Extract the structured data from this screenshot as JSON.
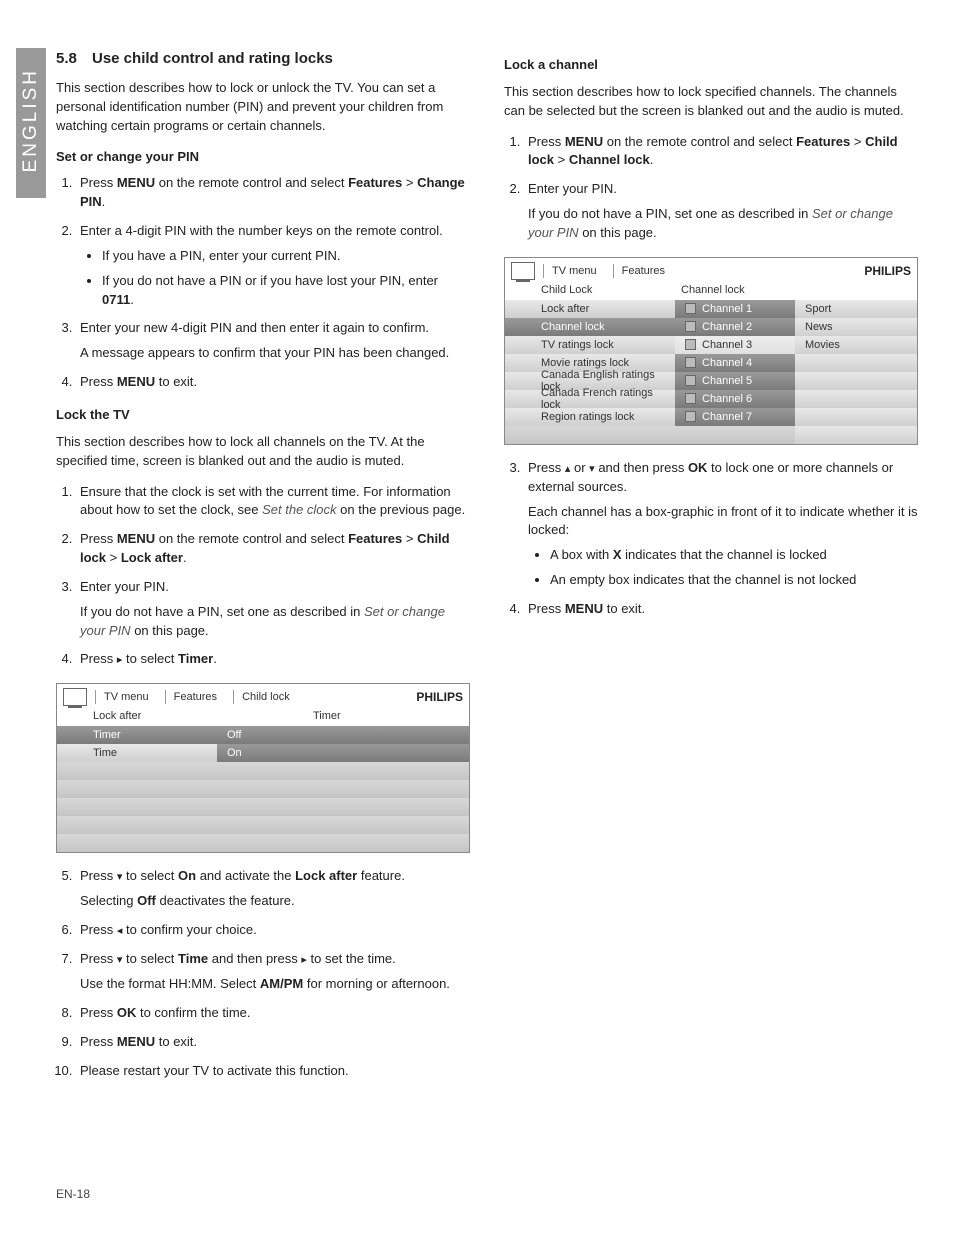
{
  "lang_tab": "ENGLISH",
  "footer": "EN-18",
  "left": {
    "heading_num": "5.8",
    "heading": "Use child control and rating locks",
    "intro": "This section describes how to lock or unlock the TV.  You can set a personal identification number (PIN) and prevent your children from watching certain programs or certain channels.",
    "pin_title": "Set or change your PIN",
    "s1a": "Press ",
    "s1b": "MENU",
    "s1c": " on the remote control and select ",
    "s1d": "Features",
    "s1e": " > ",
    "s1f": "Change PIN",
    "s1g": ".",
    "s2": "Enter a 4-digit PIN with the number keys on the remote control.",
    "s2b1": "If you have a PIN, enter your current PIN.",
    "s2b2a": "If you do not have a PIN or if you have lost your PIN, enter ",
    "s2b2b": "0711",
    "s2b2c": ".",
    "s3a": "Enter your new 4-digit PIN and then enter it again to confirm.",
    "s3b": "A message appears to confirm that your PIN has been changed.",
    "s4a": "Press ",
    "s4b": "MENU",
    "s4c": " to exit.",
    "lock_title_a": "L",
    "lock_title_b": "ock the TV",
    "lock_intro": "This section describes how to lock all channels on the TV.  At the specified time, screen is blanked out and the audio is muted.",
    "l1a": "Ensure that the clock is set with the current time.  For information about how to set the clock, see ",
    "l1b": "Set the clock",
    "l1c": " on the previous page.",
    "l2a": "Press ",
    "l2b": "MENU",
    "l2c": " on the remote control and select ",
    "l2d": "Features",
    "l2e": " > ",
    "l2f": "Child lock",
    "l2g": " > ",
    "l2h": "Lock after",
    "l2i": ".",
    "l3": "Enter your PIN.",
    "l3pa": "If you do not have a PIN, set one as described in ",
    "l3pb": "Set or change your PIN",
    "l3pc": " on this page.",
    "l4a": "Press ",
    "l4b": "▸",
    "l4c": " to select ",
    "l4d": "Timer",
    "l4e": ".",
    "l5a": "Press ",
    "l5b": "▾",
    "l5c": " to select ",
    "l5d": "On",
    "l5e": " and activate the ",
    "l5f": "Lock after",
    "l5g": " feature.",
    "l5h": "Selecting ",
    "l5i": "Off",
    "l5j": " deactivates the feature.",
    "l6a": "Press ",
    "l6b": "◂",
    "l6c": " to confirm your choice.",
    "l7a": "Press ",
    "l7b": "▾",
    "l7c": " to select ",
    "l7d": "Time",
    "l7e": " and then press ",
    "l7f": "▸",
    "l7g": " to set the time.",
    "l7h": "Use the format HH:MM.  Select ",
    "l7i": "AM/PM",
    "l7j": " for morning or afternoon.",
    "l8a": "Press ",
    "l8b": "OK",
    "l8c": " to confirm the time.",
    "l9a": "Press ",
    "l9b": "MENU",
    "l9c": " to exit.",
    "l10": "Please restart your TV to activate this function."
  },
  "menu1": {
    "brand": "PHILIPS",
    "crumbs": [
      "TV menu",
      "Features",
      "Child lock"
    ],
    "h1": "Lock after",
    "h2": "Timer",
    "rows": [
      {
        "a": "Timer",
        "b": "Off",
        "asel": true,
        "bsel": true
      },
      {
        "a": "Time",
        "b": "On",
        "bsel": true
      },
      {
        "a": "",
        "b": ""
      },
      {
        "a": "",
        "b": ""
      },
      {
        "a": "",
        "b": ""
      },
      {
        "a": "",
        "b": ""
      },
      {
        "a": "",
        "b": ""
      }
    ]
  },
  "right": {
    "title": "Lock a channel",
    "intro": "This section describes how to lock specified channels.  The channels can be selected but the screen is blanked out and the audio is muted.",
    "r1a": "Press ",
    "r1b": "MENU",
    "r1c": " on the remote control and select ",
    "r1d": "Features",
    "r1e": " > ",
    "r1f": "Child lock",
    "r1g": " > ",
    "r1h": "Channel lock",
    "r1i": ".",
    "r2": "Enter your PIN.",
    "r2pa": "If you do not have a PIN, set one as described in ",
    "r2pb": "Set or change your PIN",
    "r2pc": " on this page.",
    "r3a": "Press ",
    "r3b": "▴",
    "r3c": " or ",
    "r3d": "▾",
    "r3e": " and then press ",
    "r3f": "OK",
    "r3g": " to lock one or more channels or external sources.",
    "r3h": "Each channel has a box-graphic in front of it to indicate whether it is locked:",
    "r3b1a": "A box with ",
    "r3b1b": "X",
    "r3b1c": " indicates that the channel is locked",
    "r3b2": "An empty box indicates that the channel is not locked",
    "r4a": "Press ",
    "r4b": "MENU",
    "r4c": " to exit."
  },
  "menu2": {
    "brand": "PHILIPS",
    "crumbs": [
      "TV menu",
      "Features"
    ],
    "h1": "Child Lock",
    "h2": "Channel lock",
    "rows": [
      {
        "a": "Lock after",
        "b": "Channel 1",
        "c": "Sport",
        "bsel": true
      },
      {
        "a": "Channel lock",
        "b": "Channel 2",
        "c": "News",
        "asel": true,
        "bsel": true
      },
      {
        "a": "TV ratings lock",
        "b": "Channel 3",
        "c": "Movies",
        "bwhite": true
      },
      {
        "a": "Movie ratings lock",
        "b": "Channel 4",
        "c": "",
        "bsel": true
      },
      {
        "a": "Canada English ratings lock",
        "b": "Channel 5",
        "c": "",
        "bsel": true
      },
      {
        "a": "Canada French ratings lock",
        "b": "Channel 6",
        "c": "",
        "bsel": true
      },
      {
        "a": "Region ratings lock",
        "b": "Channel 7",
        "c": "",
        "bsel": true
      },
      {
        "a": "",
        "b": "",
        "c": ""
      }
    ]
  }
}
